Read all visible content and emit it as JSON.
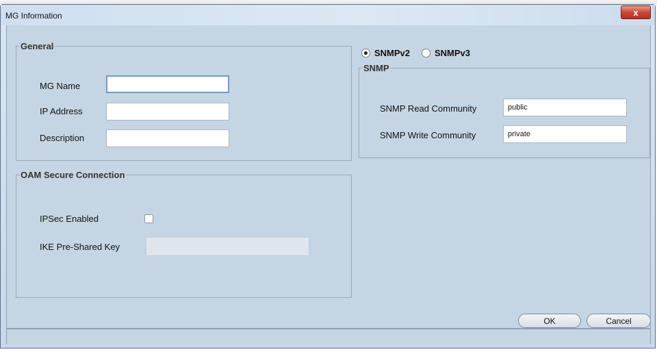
{
  "window": {
    "title": "MG Information",
    "close_glyph": "x"
  },
  "general": {
    "legend": "General",
    "mg_name_label": "MG Name",
    "mg_name_value": "",
    "ip_label": "IP Address",
    "ip_value": "",
    "description_label": "Description",
    "description_value": ""
  },
  "oam": {
    "legend": "OAM Secure Connection",
    "ipsec_label": "IPSec Enabled",
    "ipsec_checked": false,
    "ike_label": "IKE Pre-Shared Key",
    "ike_value": ""
  },
  "snmp_version": {
    "options": [
      "SNMPv2",
      "SNMPv3"
    ],
    "selected": "SNMPv2"
  },
  "snmp": {
    "legend": "SNMP",
    "read_label": "SNMP Read Community",
    "read_value": "public",
    "write_label": "SNMP Write Community",
    "write_value": "private"
  },
  "buttons": {
    "ok": "OK",
    "cancel": "Cancel"
  },
  "colors": {
    "dialog_bg": "#c6d5e3",
    "close_button": "#c8493a"
  }
}
